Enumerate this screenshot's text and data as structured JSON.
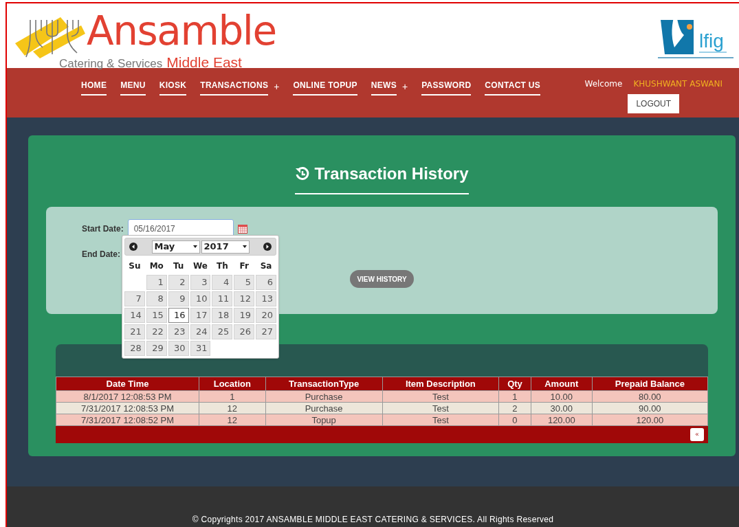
{
  "header": {
    "logo": {
      "name": "Ansamble",
      "tagline": "Catering & Services",
      "region": "Middle East"
    },
    "partner_logo": {
      "name": "lfig"
    }
  },
  "nav": {
    "items": [
      {
        "label": "HOME"
      },
      {
        "label": "MENU"
      },
      {
        "label": "KIOSK"
      },
      {
        "label": "TRANSACTIONS",
        "toggle": "+"
      },
      {
        "label": "ONLINE TOPUP"
      },
      {
        "label": "NEWS",
        "toggle": "+"
      },
      {
        "label": "PASSWORD"
      },
      {
        "label": "CONTACT US"
      }
    ],
    "welcome": "Welcome",
    "user": "KHUSHWANT ASWANI",
    "logout": "LOGOUT"
  },
  "page_title": "Transaction History",
  "form": {
    "start_label": "Start Date:",
    "start_value": "05/16/2017",
    "end_label": "End Date:",
    "submit": "VIEW HISTORY"
  },
  "datepicker": {
    "month": "May",
    "year": "2017",
    "weekdays": [
      "Su",
      "Mo",
      "Tu",
      "We",
      "Th",
      "Fr",
      "Sa"
    ],
    "weeks": [
      [
        {
          "day": "1",
          "selected": false
        },
        {
          "day": "2",
          "selected": false
        },
        {
          "day": "3",
          "selected": false
        },
        {
          "day": "4",
          "selected": false
        },
        {
          "day": "5",
          "selected": false
        },
        {
          "day": "6",
          "selected": false
        }
      ],
      [
        {
          "day": "7",
          "selected": false
        },
        {
          "day": "8",
          "selected": false
        },
        {
          "day": "9",
          "selected": false
        },
        {
          "day": "10",
          "selected": false
        },
        {
          "day": "11",
          "selected": false
        },
        {
          "day": "12",
          "selected": false
        },
        {
          "day": "13",
          "selected": false
        }
      ],
      [
        {
          "day": "14",
          "selected": false
        },
        {
          "day": "15",
          "selected": false
        },
        {
          "day": "16",
          "selected": true
        },
        {
          "day": "17",
          "selected": false
        },
        {
          "day": "18",
          "selected": false
        },
        {
          "day": "19",
          "selected": false
        },
        {
          "day": "20",
          "selected": false
        }
      ],
      [
        {
          "day": "21",
          "selected": false
        },
        {
          "day": "22",
          "selected": false
        },
        {
          "day": "23",
          "selected": false
        },
        {
          "day": "24",
          "selected": false
        },
        {
          "day": "25",
          "selected": false
        },
        {
          "day": "26",
          "selected": false
        },
        {
          "day": "27",
          "selected": false
        }
      ],
      [
        {
          "day": "28",
          "selected": false
        },
        {
          "day": "29",
          "selected": false
        },
        {
          "day": "30",
          "selected": false
        },
        {
          "day": "31",
          "selected": false
        }
      ]
    ]
  },
  "table": {
    "columns": [
      "Date Time",
      "Location",
      "TransactionType",
      "Item Description",
      "Qty",
      "Amount",
      "Prepaid Balance"
    ],
    "rows": [
      [
        "8/1/2017 12:08:53 PM",
        "1",
        "Purchase",
        "Test",
        "1",
        "10.00",
        "80.00"
      ],
      [
        "7/31/2017 12:08:53 PM",
        "12",
        "Purchase",
        "Test",
        "2",
        "30.00",
        "90.00"
      ],
      [
        "7/31/2017 12:08:52 PM",
        "12",
        "Topup",
        "Test",
        "0",
        "120.00",
        "120.00"
      ]
    ],
    "pager": "«"
  },
  "footer": "© Copyrights 2017 ANSAMBLE MIDDLE EAST CATERING & SERVICES. All Rights Reserved"
}
